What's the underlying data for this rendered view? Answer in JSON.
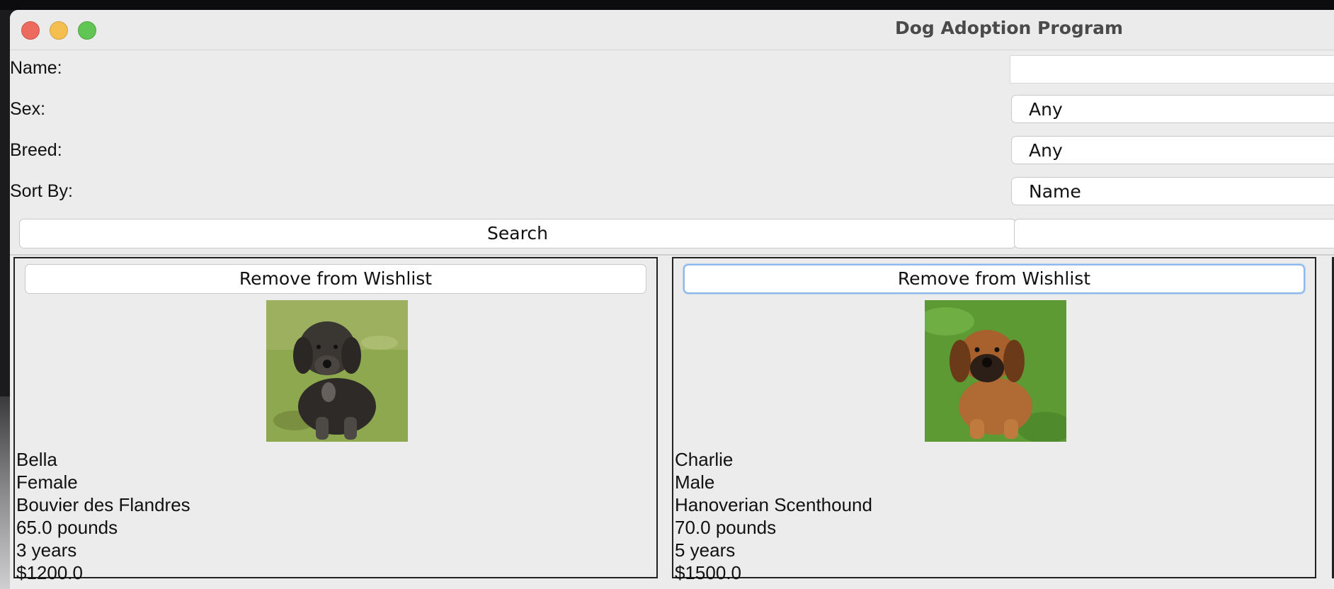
{
  "window": {
    "title": "Dog Adoption Program"
  },
  "filters": {
    "name_label": "Name:",
    "name_value": "",
    "sex_label": "Sex:",
    "sex_value": "Any",
    "breed_label": "Breed:",
    "breed_value": "Any",
    "sort_label": "Sort By:",
    "sort_value": "Name",
    "search_button": "Search"
  },
  "dogs": [
    {
      "button": "Remove from Wishlist",
      "name": "Bella",
      "sex": "Female",
      "breed": "Bouvier des Flandres",
      "weight": "65.0 pounds",
      "age": "3 years",
      "price": "$1200.0"
    },
    {
      "button": "Remove from Wishlist",
      "name": "Charlie",
      "sex": "Male",
      "breed": "Hanoverian Scenthound",
      "weight": "70.0 pounds",
      "age": "5 years",
      "price": "$1500.0"
    }
  ]
}
